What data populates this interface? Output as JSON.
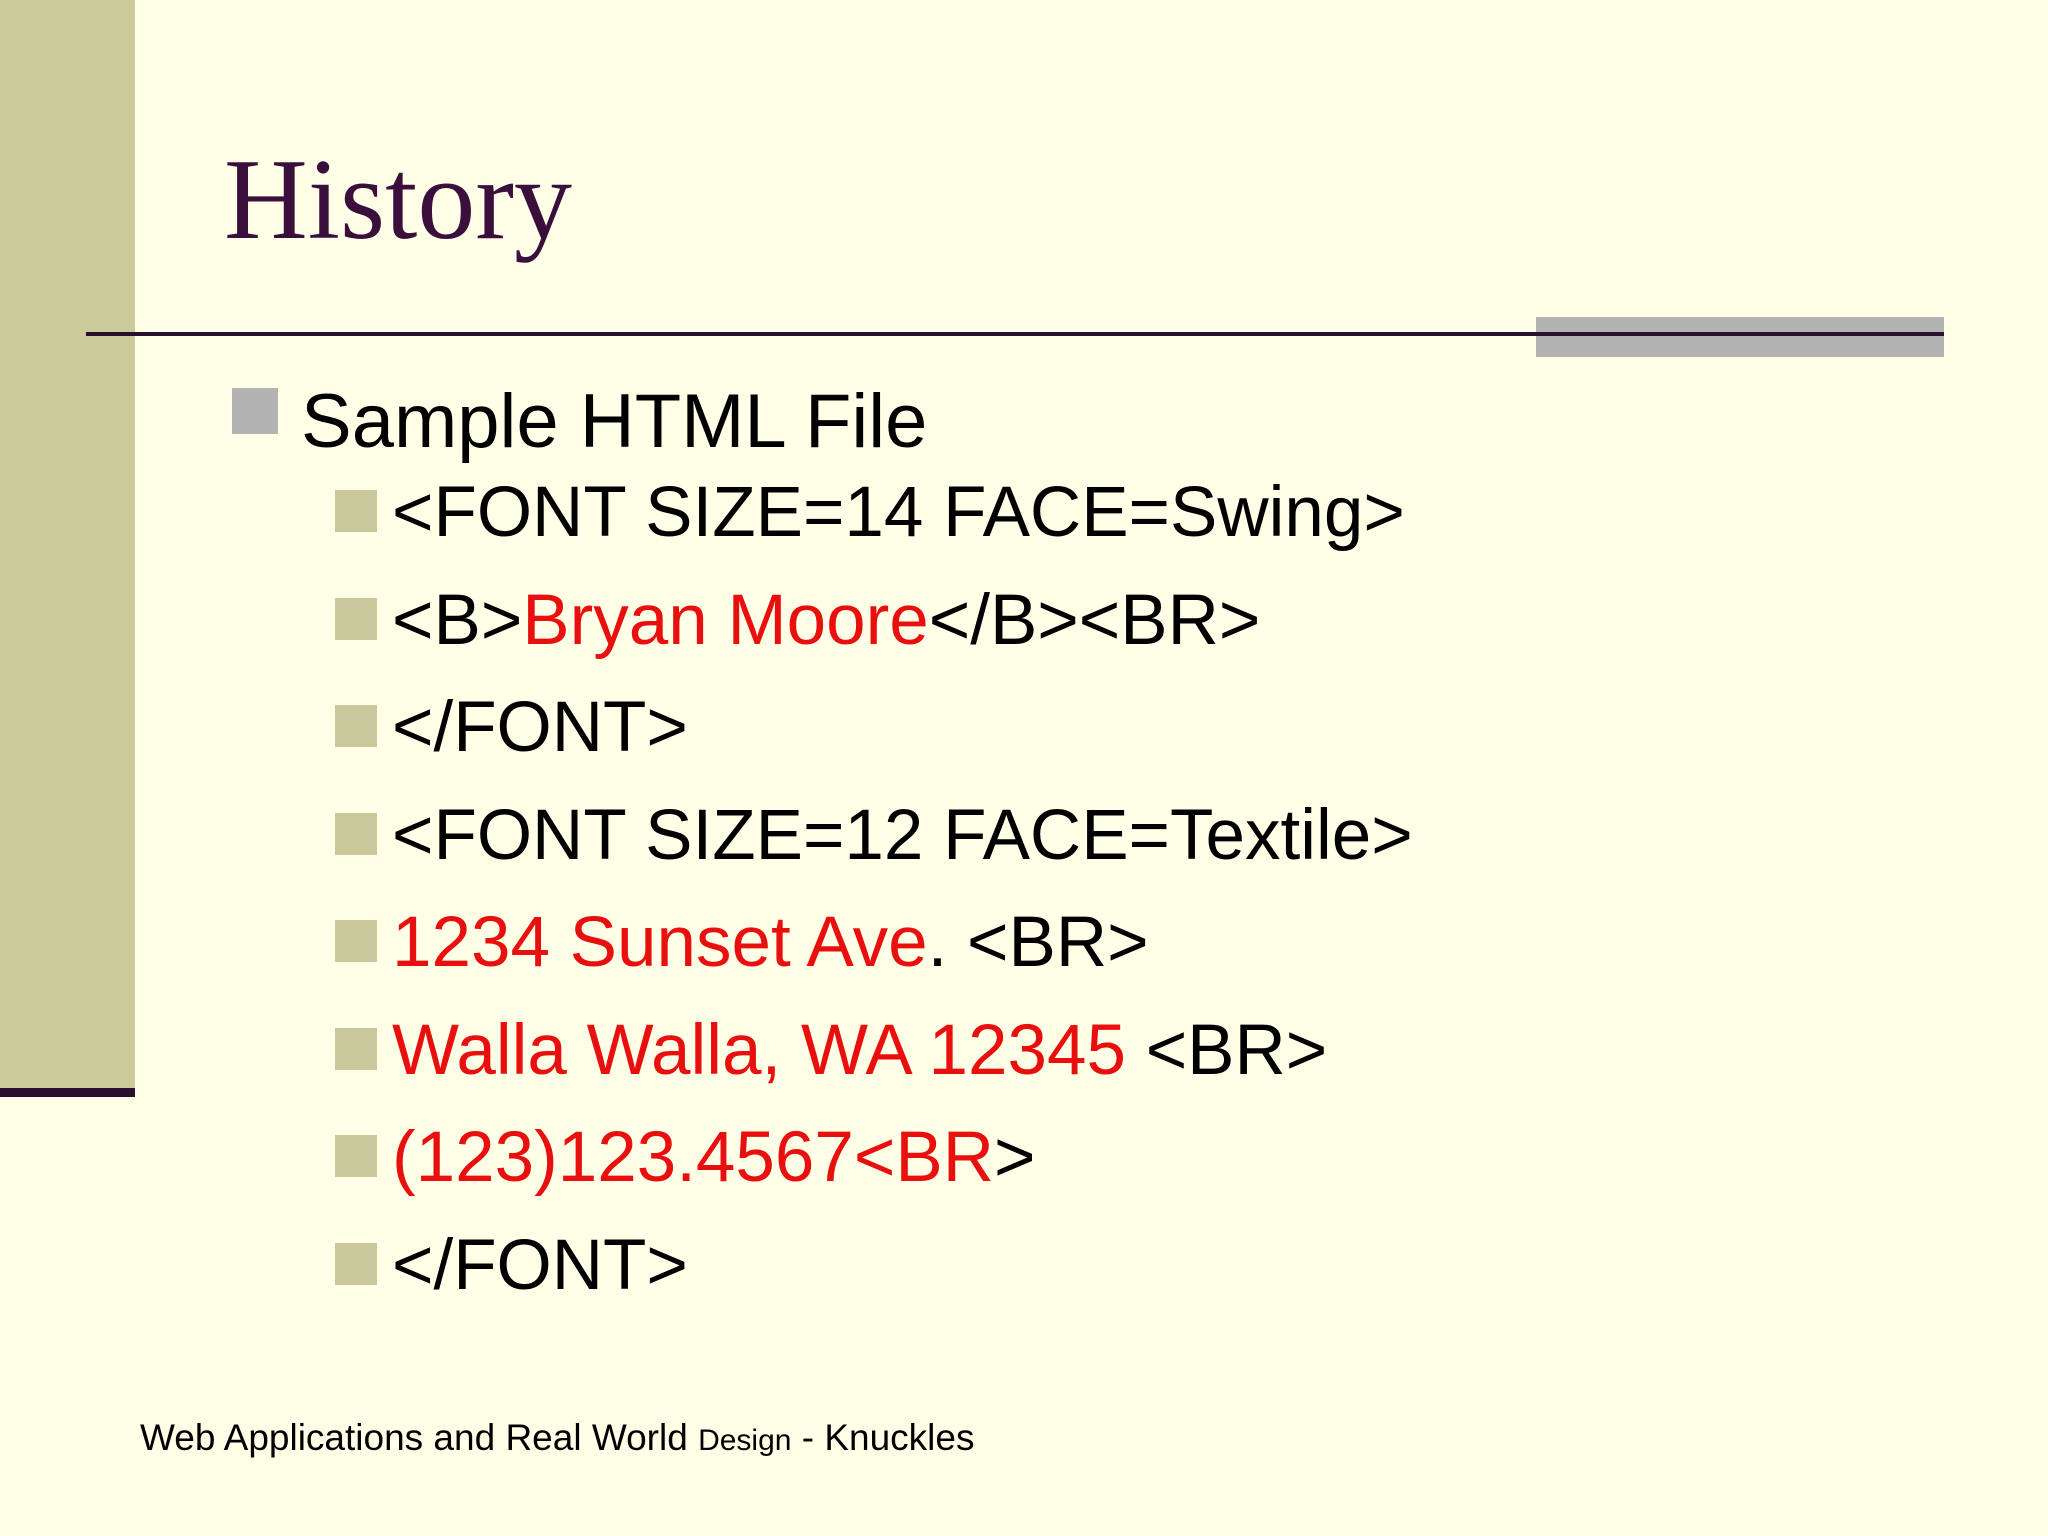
{
  "slide": {
    "title": "History",
    "bullet_l1": "Sample HTML File",
    "items": [
      {
        "parts": [
          {
            "text": "<FONT SIZE=14 FACE=Swing>",
            "color": "black"
          }
        ]
      },
      {
        "parts": [
          {
            "text": "<B>",
            "color": "black"
          },
          {
            "text": "Bryan Moore",
            "color": "red"
          },
          {
            "text": "</B><BR>",
            "color": "black"
          }
        ]
      },
      {
        "parts": [
          {
            "text": "</FONT>",
            "color": "black"
          }
        ]
      },
      {
        "parts": [
          {
            "text": "<FONT SIZE=12 FACE=Textile>",
            "color": "black"
          }
        ]
      },
      {
        "parts": [
          {
            "text": "1234 Sunset Ave",
            "color": "red"
          },
          {
            "text": ". <BR>",
            "color": "black"
          }
        ]
      },
      {
        "parts": [
          {
            "text": "Walla Walla, WA 12345",
            "color": "red"
          },
          {
            "text": " <BR>",
            "color": "black"
          }
        ]
      },
      {
        "parts": [
          {
            "text": "(123)123.4567<BR",
            "color": "red"
          },
          {
            "text": ">",
            "color": "black"
          }
        ]
      },
      {
        "parts": [
          {
            "text": "</FONT>",
            "color": "black"
          }
        ]
      }
    ],
    "footer": {
      "part1": "Web Applications and Real World",
      "part2": "Design",
      "part3": "- Knuckles"
    }
  },
  "colors": {
    "background": "#FFFFE8",
    "sidebar": "#CBCB9C",
    "title": "#3A0F3C",
    "rule": "#2B0F2E",
    "accent_gray": "#B3B3B3",
    "red_text": "#E8100F"
  }
}
